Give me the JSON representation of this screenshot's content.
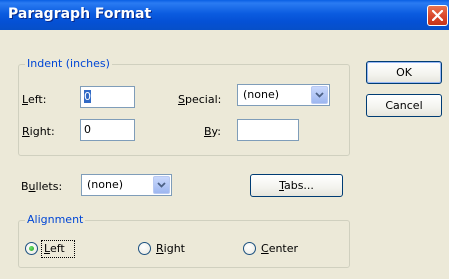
{
  "window": {
    "title": "Paragraph Format"
  },
  "indent": {
    "group_label": "Indent (inches)",
    "left_label": "Left:",
    "left_value": "0",
    "right_label": "Right:",
    "right_value": "0",
    "special_label": "Special:",
    "special_value": "(none)",
    "by_label": "By:",
    "by_value": ""
  },
  "bullets": {
    "label": "Bullets:",
    "value": "(none)"
  },
  "buttons": {
    "ok": "OK",
    "cancel": "Cancel",
    "tabs": "Tabs..."
  },
  "alignment": {
    "group_label": "Alignment",
    "options": [
      {
        "label": "Left",
        "selected": true
      },
      {
        "label": "Right",
        "selected": false
      },
      {
        "label": "Center",
        "selected": false
      }
    ]
  },
  "icons": {
    "close": "close-icon",
    "dropdown": "chevron-down-icon"
  },
  "colors": {
    "titlebar": "#0a5fe3",
    "group_label": "#0046d5",
    "close_button": "#d9462b"
  }
}
